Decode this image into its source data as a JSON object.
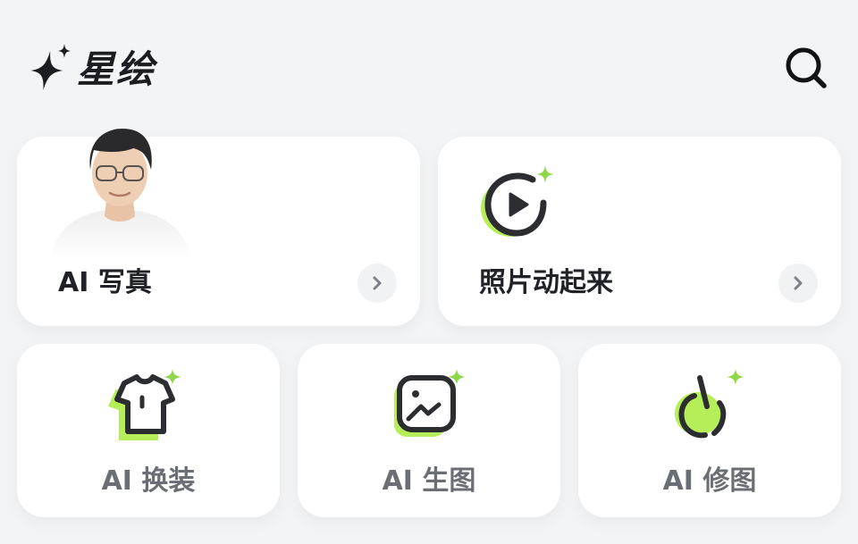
{
  "header": {
    "app_name": "星绘",
    "logo_icon": "sparkle-icon",
    "search_icon": "search-icon"
  },
  "features": {
    "photo": {
      "label": "AI 写真",
      "arrow_icon": "chevron-right-icon"
    },
    "motion": {
      "label": "照片动起来",
      "icon": "play-sparkle-icon",
      "arrow_icon": "chevron-right-icon"
    },
    "outfit": {
      "label": "AI 换装",
      "icon": "shirt-sparkle-icon"
    },
    "generate": {
      "label": "AI 生图",
      "icon": "image-sparkle-icon"
    },
    "retouch": {
      "label": "AI 修图",
      "icon": "retouch-sparkle-icon"
    }
  },
  "colors": {
    "background": "#f3f4f6",
    "card": "#ffffff",
    "accent_green": "#b6ee5a",
    "ink": "#1f2126",
    "muted_label": "#6b6e74"
  }
}
